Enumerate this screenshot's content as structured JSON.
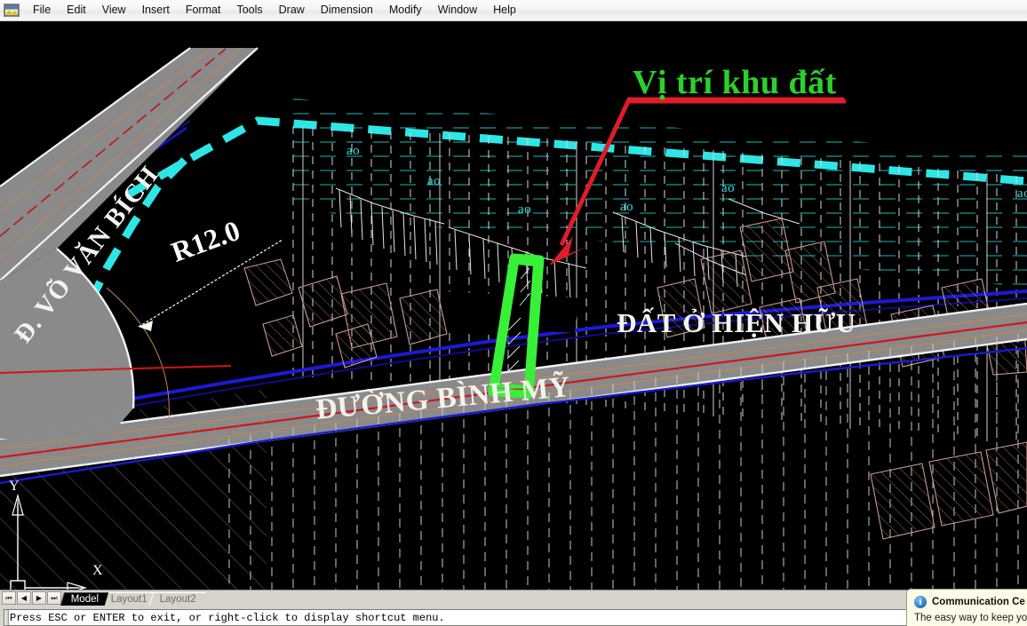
{
  "app": {
    "icon": "autocad-app-icon"
  },
  "menu": {
    "items": [
      {
        "label": "File"
      },
      {
        "label": "Edit"
      },
      {
        "label": "View"
      },
      {
        "label": "Insert"
      },
      {
        "label": "Format"
      },
      {
        "label": "Tools"
      },
      {
        "label": "Draw"
      },
      {
        "label": "Dimension"
      },
      {
        "label": "Modify"
      },
      {
        "label": "Window"
      },
      {
        "label": "Help"
      }
    ]
  },
  "drawing": {
    "title_label": "Vị trí khu đất",
    "road_main_label": "ĐƯỜNG BÌNH MỸ",
    "road_side_label": "Đ. VÕ VĂN BÍCH",
    "area_label": "ĐẤT Ở HIỆN HỮU",
    "radius_dimension": "R12.0",
    "pond_labels": [
      "ao",
      "ao",
      "ao",
      "ao",
      "ao",
      "ao"
    ],
    "ucs": {
      "x_axis": "X",
      "y_axis": "Y"
    },
    "colors": {
      "background": "#000000",
      "highlight_parcel": "#39f039",
      "leader": "#e01b2a",
      "title_text": "#2bd12b",
      "boundary_cyan": "#2ee6e6",
      "boundary_blue": "#1a1ad6",
      "road_fill": "#8a8a8a",
      "road_centerline": "#d41414",
      "building_outline": "#c79a90",
      "hatch_white": "#d7d7d7",
      "pond_text": "#31e3e3"
    }
  },
  "tabs": {
    "nav_first": "⏮",
    "nav_prev": "◀",
    "nav_next": "▶",
    "nav_last": "⏭",
    "items": [
      {
        "label": "Model",
        "active": true
      },
      {
        "label": "Layout1",
        "active": false
      },
      {
        "label": "Layout2",
        "active": false
      }
    ]
  },
  "command_line": {
    "text": "Press ESC or ENTER to exit, or right-click to display shortcut menu."
  },
  "balloon": {
    "icon": "info-icon",
    "title": "Communication Ce",
    "body": "The easy way to keep you"
  }
}
